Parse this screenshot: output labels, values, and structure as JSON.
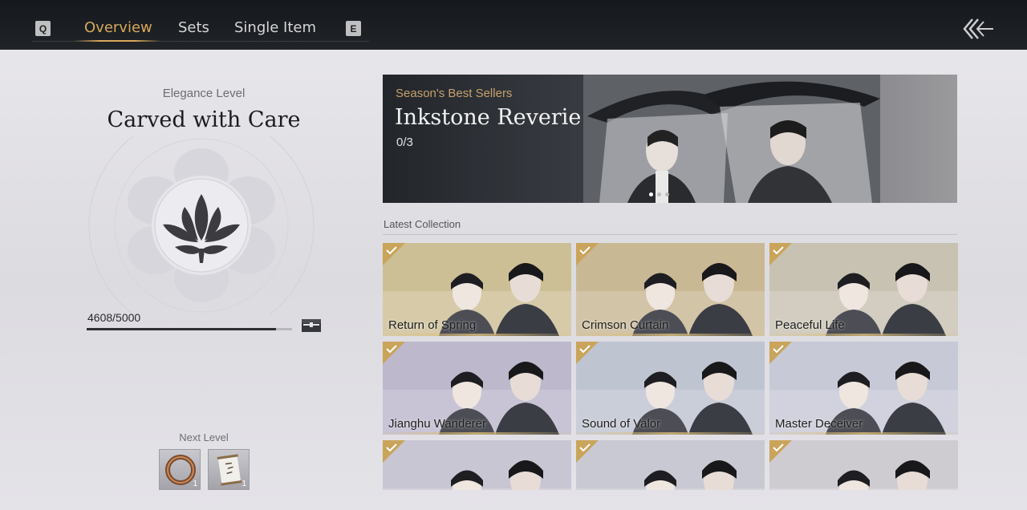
{
  "topbar": {
    "key_left": "Q",
    "key_right": "E",
    "tabs": [
      {
        "label": "Overview",
        "active": true
      },
      {
        "label": "Sets",
        "active": false
      },
      {
        "label": "Single Item",
        "active": false
      }
    ]
  },
  "elegance": {
    "label": "Elegance Level",
    "title": "Carved with Care",
    "progress_text": "4608/5000",
    "progress_fraction": 0.9216,
    "next_level_label": "Next Level",
    "rewards": [
      {
        "icon": "bracelet-icon",
        "qty": "1"
      },
      {
        "icon": "scroll-icon",
        "qty": "1"
      }
    ]
  },
  "banner": {
    "subtitle": "Season's Best Sellers",
    "title": "Inkstone Reverie",
    "count": "0/3",
    "slides": 3,
    "active_slide": 1
  },
  "latest": {
    "label": "Latest Collection",
    "items": [
      {
        "name": "Return of Spring",
        "bg": "#cdbf95",
        "owned": true
      },
      {
        "name": "Crimson Curtain",
        "bg": "#c9b894",
        "owned": true
      },
      {
        "name": "Peaceful Life",
        "bg": "#c8c2b2",
        "owned": true
      },
      {
        "name": "Jianghu Wanderer",
        "bg": "#bdb8cc",
        "owned": true
      },
      {
        "name": "Sound of Valor",
        "bg": "#bfc4d1",
        "owned": true
      },
      {
        "name": "Master Deceiver",
        "bg": "#c7c9d6",
        "owned": true
      },
      {
        "name": "",
        "bg": "#c8c6d3",
        "owned": true
      },
      {
        "name": "",
        "bg": "#c9c9d3",
        "owned": true
      },
      {
        "name": "",
        "bg": "#cfccd1",
        "owned": true
      }
    ]
  },
  "colors": {
    "accent_gold": "#d9a85a",
    "badge_gold": "#c9a45a",
    "topbar": "#1a1d21"
  }
}
